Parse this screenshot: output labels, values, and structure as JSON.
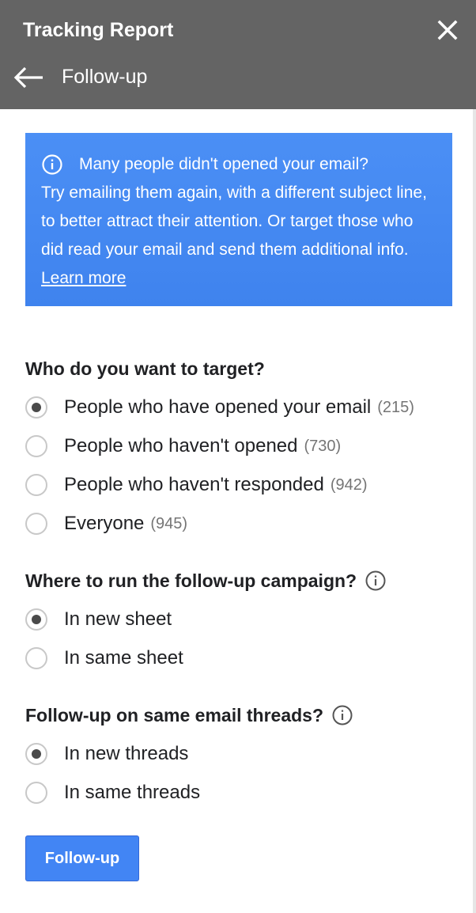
{
  "header": {
    "title": "Tracking Report",
    "subtitle": "Follow-up",
    "icons": {
      "close": "close-icon",
      "back": "arrow-left-icon"
    }
  },
  "info": {
    "headline": "Many people didn't opened your email?",
    "body": "Try emailing them again, with a different subject line, to better attract their attention. Or target those who did read your email and send them additional info.",
    "link": "Learn more",
    "bg_color": "#4285f4"
  },
  "target": {
    "title": "Who do you want to target?",
    "options": [
      {
        "label": "People who have opened your email",
        "count": "(215)",
        "selected": true
      },
      {
        "label": "People who haven't opened",
        "count": "(730)",
        "selected": false
      },
      {
        "label": "People who haven't responded",
        "count": "(942)",
        "selected": false
      },
      {
        "label": "Everyone",
        "count": "(945)",
        "selected": false
      }
    ]
  },
  "campaign": {
    "title": "Where to run the follow-up campaign?",
    "options": [
      {
        "label": "In new sheet",
        "selected": true
      },
      {
        "label": "In same sheet",
        "selected": false
      }
    ]
  },
  "threads": {
    "title": "Follow-up on same email threads?",
    "options": [
      {
        "label": "In new threads",
        "selected": true
      },
      {
        "label": "In same threads",
        "selected": false
      }
    ]
  },
  "action": {
    "button_label": "Follow-up",
    "color": "#4285f4"
  }
}
